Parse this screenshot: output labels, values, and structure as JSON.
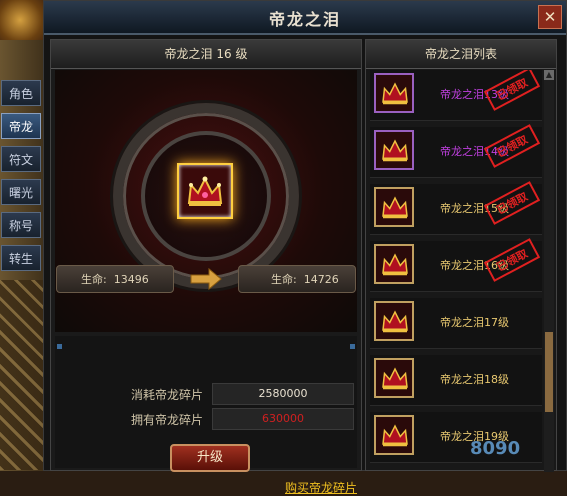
{
  "window": {
    "title": "帝龙之泪",
    "close_label": "✕"
  },
  "tabs": [
    {
      "label": "角色"
    },
    {
      "label": "帝龙",
      "active": true
    },
    {
      "label": "符文"
    },
    {
      "label": "曙光"
    },
    {
      "label": "称号"
    },
    {
      "label": "转生"
    }
  ],
  "left": {
    "header": "帝龙之泪 16 级",
    "current_stat": {
      "label": "生命:",
      "value": "13496"
    },
    "next_stat": {
      "label": "生命:",
      "value": "14726"
    },
    "cost_label": "消耗帝龙碎片",
    "cost_value": "2580000",
    "owned_label": "拥有帝龙碎片",
    "owned_value": "630000",
    "upgrade_button": "升级",
    "buy_link": "购买帝龙碎片"
  },
  "right": {
    "header": "帝龙之泪列表",
    "items": [
      {
        "name": "帝龙之泪13级",
        "stamp": "已领取",
        "quality": "purple"
      },
      {
        "name": "帝龙之泪14级",
        "stamp": "已领取",
        "quality": "purple"
      },
      {
        "name": "帝龙之泪15级",
        "stamp": "已领取",
        "quality": "gold"
      },
      {
        "name": "帝龙之泪16级",
        "stamp": "已领取",
        "quality": "gold"
      },
      {
        "name": "帝龙之泪17级",
        "stamp": "",
        "quality": "gold"
      },
      {
        "name": "帝龙之泪18级",
        "stamp": "",
        "quality": "gold"
      },
      {
        "name": "帝龙之泪19级",
        "stamp": "",
        "quality": "gold"
      }
    ]
  },
  "watermark": "8090",
  "colors": {
    "gold_text": "#e8c870",
    "purple_text": "#c040e0",
    "stamp_red": "#e02020",
    "owned_red": "#d02020",
    "link_yellow": "#f0c020"
  }
}
